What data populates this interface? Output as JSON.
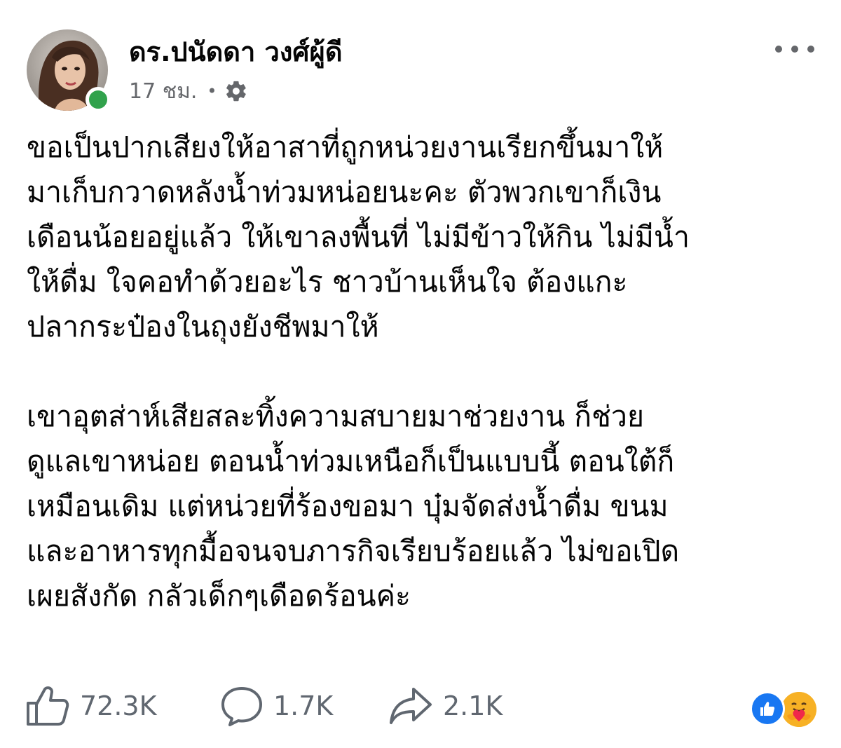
{
  "post": {
    "author_name": "ดร.ปนัดดา วงศ์ผู้ดี",
    "timestamp": "17 ชม.",
    "meta_separator": "•",
    "privacy_icon": "gear-icon",
    "paragraphs": [
      "ขอเป็นปากเสียงให้อาสาที่ถูกหน่วยงานเรียกขึ้นมาให้\nมาเก็บกวาดหลังน้ำท่วมหน่อยนะคะ ตัวพวกเขาก็เงิน\nเดือนน้อยอยู่แล้ว ให้เขาลงพื้นที่ ไม่มีข้าวให้กิน ไม่มีน้ำ\nให้ดื่ม ใจคอทำด้วยอะไร ชาวบ้านเห็นใจ ต้องแกะ\nปลากระป๋องในถุงยังชีพมาให้",
      "เขาอุตส่าห์เสียสละทิ้งความสบายมาช่วยงาน ก็ช่วย\nดูแลเขาหน่อย ตอนน้ำท่วมเหนือก็เป็นแบบนี้ ตอนใต้ก็\nเหมือนเดิม แต่หน่วยที่ร้องขอมา บุ๋มจัดส่งน้ำดื่ม ขนม\nและอาหารทุกมื้อจนจบภารกิจเรียบร้อยแล้ว ไม่ขอเปิด\nเผยสังกัด กลัวเด็กๆเดือดร้อนค่ะ"
    ]
  },
  "actions": {
    "like_count": "72.3K",
    "comment_count": "1.7K",
    "share_count": "2.1K"
  },
  "reactions": [
    "like-reaction-icon",
    "care-reaction-icon"
  ],
  "colors": {
    "online": "#31a24c",
    "like_blue": "#1877f2",
    "secondary_text": "#65676b"
  }
}
